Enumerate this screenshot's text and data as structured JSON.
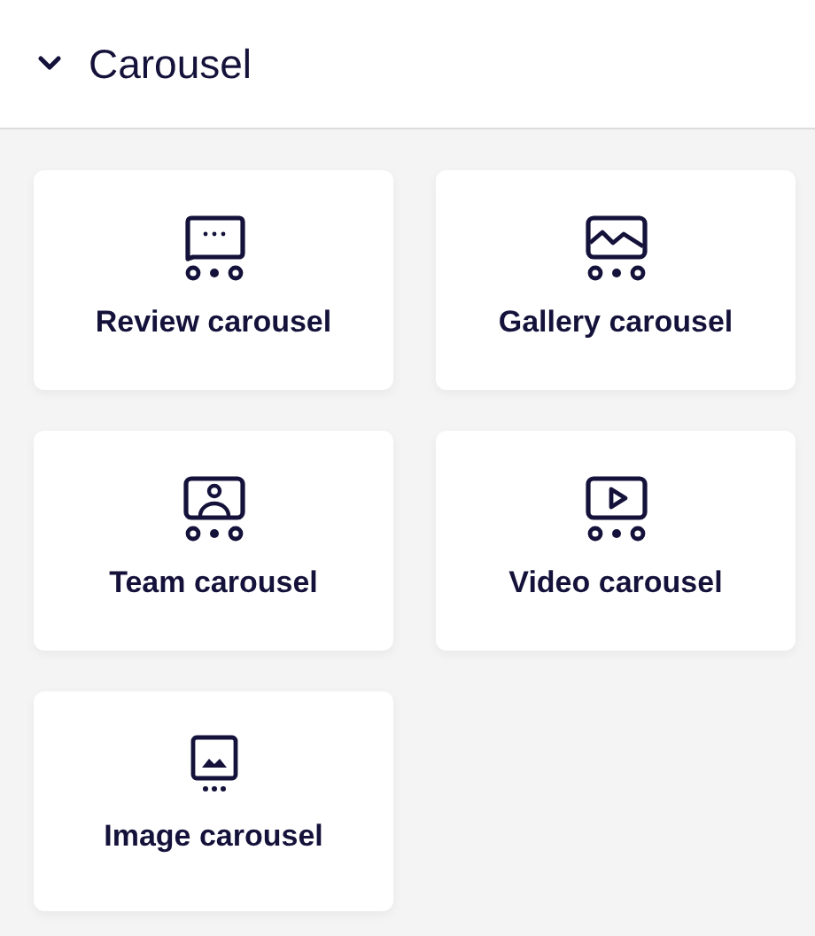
{
  "section": {
    "title": "Carousel",
    "expanded": true
  },
  "items": [
    {
      "label": "Review carousel",
      "kind": "review"
    },
    {
      "label": "Gallery carousel",
      "kind": "gallery"
    },
    {
      "label": "Team carousel",
      "kind": "team"
    },
    {
      "label": "Video carousel",
      "kind": "video"
    },
    {
      "label": "Image carousel",
      "kind": "image"
    }
  ]
}
